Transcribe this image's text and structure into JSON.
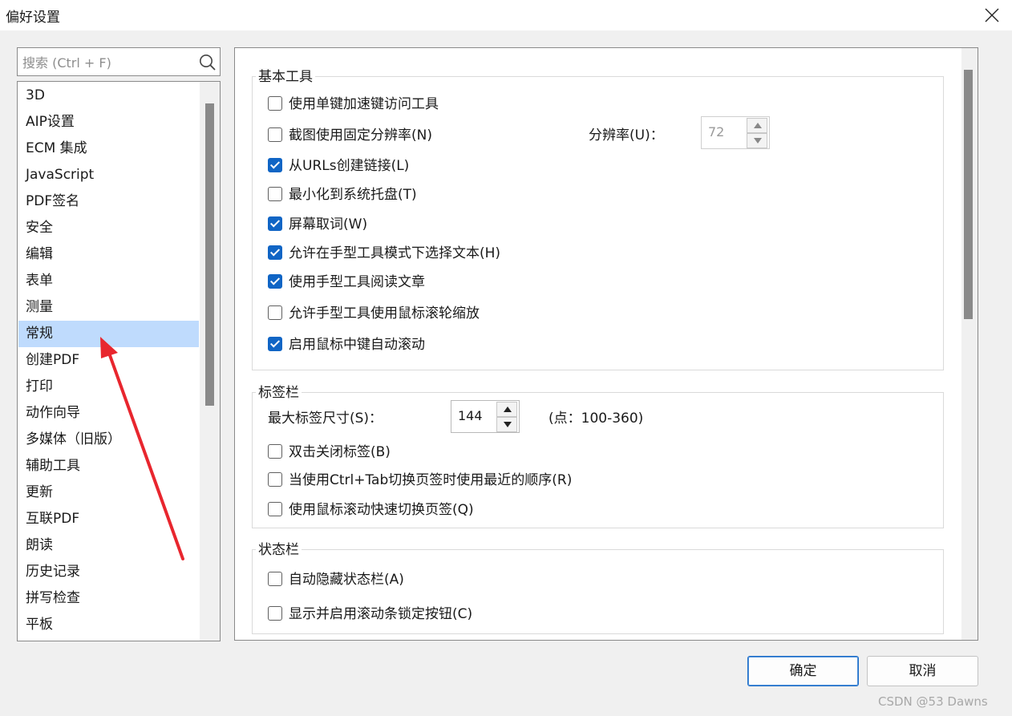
{
  "window": {
    "title": "偏好设置",
    "close_icon": "close-icon"
  },
  "sidebar": {
    "search_placeholder": "搜索 (Ctrl + F)",
    "search_icon": "search-icon",
    "selected": "常规",
    "items": [
      "3D",
      "AIP设置",
      "ECM 集成",
      "JavaScript",
      "PDF签名",
      "安全",
      "编辑",
      "表单",
      "测量",
      "常规",
      "创建PDF",
      "打印",
      "动作向导",
      "多媒体（旧版）",
      "辅助工具",
      "更新",
      "互联PDF",
      "朗读",
      "历史记录",
      "拼写检查",
      "平板"
    ]
  },
  "basic_tools": {
    "title": "基本工具",
    "single_key": {
      "label": "使用单键加速键访问工具",
      "checked": false
    },
    "fixed_resolution": {
      "label": "截图使用固定分辨率(N)",
      "checked": false
    },
    "resolution_label": "分辨率(U)：",
    "resolution_value": "72",
    "urls_links": {
      "label": "从URLs创建链接(L)",
      "checked": true
    },
    "minimize_tray": {
      "label": "最小化到系统托盘(T)",
      "checked": false
    },
    "screen_word": {
      "label": "屏幕取词(W)",
      "checked": true
    },
    "hand_select_text": {
      "label": "允许在手型工具模式下选择文本(H)",
      "checked": true
    },
    "hand_read_article": {
      "label": "使用手型工具阅读文章",
      "checked": true
    },
    "hand_wheel_zoom": {
      "label": "允许手型工具使用鼠标滚轮缩放",
      "checked": false
    },
    "middle_autoscroll": {
      "label": "启用鼠标中键自动滚动",
      "checked": true
    }
  },
  "tab_bar": {
    "title": "标签栏",
    "max_width_label": "最大标签尺寸(S)：",
    "max_width_value": "144",
    "range_hint": "(点：100-360)",
    "double_click_close": {
      "label": "双击关闭标签(B)",
      "checked": false
    },
    "ctrl_tab_recent": {
      "label": "当使用Ctrl+Tab切换页签时使用最近的顺序(R)",
      "checked": false
    },
    "wheel_switch": {
      "label": "使用鼠标滚动快速切换页签(Q)",
      "checked": false
    }
  },
  "status_bar": {
    "title": "状态栏",
    "auto_hide": {
      "label": "自动隐藏状态栏(A)",
      "checked": false
    },
    "scroll_lock": {
      "label": "显示并启用滚动条锁定按钮(C)",
      "checked": false
    }
  },
  "footer": {
    "ok_label": "确定",
    "cancel_label": "取消"
  },
  "watermark": "CSDN @53    Dawns",
  "colors": {
    "accent": "#1065c5",
    "selection": "#bfdbfd",
    "arrow": "#e8262e"
  }
}
